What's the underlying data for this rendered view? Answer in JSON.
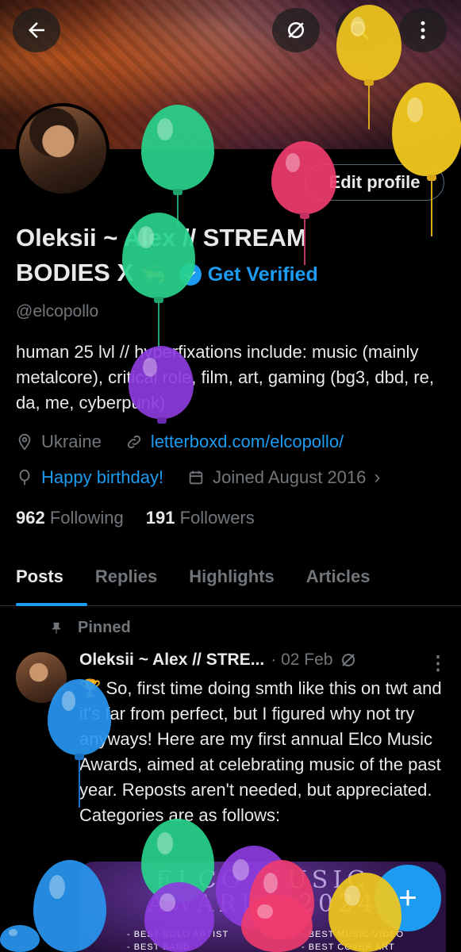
{
  "profile": {
    "display_name": "Oleksii ~ Alex // STREAM BODIES X",
    "verified_label": "Get Verified",
    "handle": "@elcopollo",
    "bio": "human 25 lvl // hyperfixations include: music (mainly metalcore), critical role, film, art, gaming (bg3, dbd, re, da, me, cyberpunk)",
    "location": "Ukraine",
    "website": "letterboxd.com/elcopollo/",
    "birthday": "Happy birthday!",
    "joined": "Joined August 2016",
    "following_count": "962",
    "following_label": "Following",
    "followers_count": "191",
    "followers_label": "Followers",
    "edit_profile_label": "Edit profile"
  },
  "tabs": [
    "Posts",
    "Replies",
    "Highlights",
    "Articles"
  ],
  "pinned_post": {
    "pinned_label": "Pinned",
    "author": "Oleksii ~ Alex // STRE...",
    "date": "· 02 Feb",
    "text": "🏆 So, first time doing smth like this on twt and it's far from perfect, but I figured why not try anyways! Here are my first annual Elco Music Awards, aimed at celebrating music of the past year. Reposts aren't needed, but appreciated. Categories are as follows:",
    "media_title_1": "ELCO MUSIC",
    "media_title_2": "AWARDS 2024",
    "media_line_1": "- BEST SOLO ARTIST",
    "media_line_2": "- BEST BAND",
    "media_line_3": "- BEST MUSIC VIDEO",
    "media_line_4": "- BEST COVER ART"
  },
  "icons": {
    "back": "arrow-left-icon",
    "no_sync": "strikethrough-circle-icon",
    "search": "search-icon",
    "more": "more-vertical-icon",
    "location": "location-pin-icon",
    "link": "link-icon",
    "birthday": "balloon-icon",
    "calendar": "calendar-icon",
    "pin": "pin-icon",
    "compose": "plus-icon"
  },
  "colors": {
    "accent": "#1d9bf0",
    "text": "#e7e9ea",
    "muted": "#71767b",
    "background": "#000000"
  }
}
